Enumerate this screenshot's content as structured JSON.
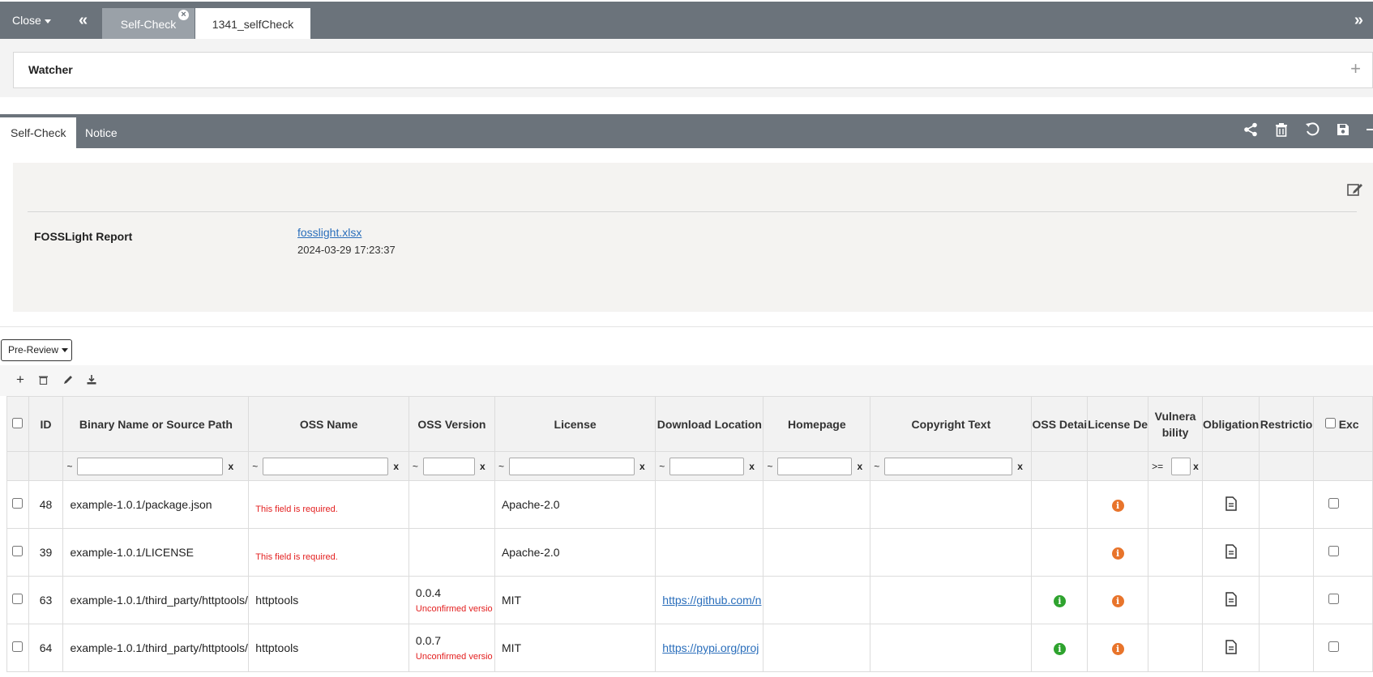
{
  "topbar": {
    "close_label": "Close",
    "tabs": [
      {
        "label": "Self-Check",
        "active": false
      },
      {
        "label": "1341_selfCheck",
        "active": true
      }
    ]
  },
  "watcher": {
    "title": "Watcher"
  },
  "subtabs": [
    {
      "label": "Self-Check",
      "active": true
    },
    {
      "label": "Notice",
      "active": false
    }
  ],
  "toolbar_icons": [
    "share-icon",
    "trash-icon",
    "undo-icon",
    "save-icon"
  ],
  "report": {
    "label": "FOSSLight Report",
    "file": "fosslight.xlsx",
    "date": "2024-03-29 17:23:37"
  },
  "prereview_label": "Pre-Review",
  "grid": {
    "columns": [
      "ID",
      "Binary Name or Source Path",
      "OSS Name",
      "OSS Version",
      "License",
      "Download Location",
      "Homepage",
      "Copyright Text",
      "OSS Detai",
      "License De",
      "Vulnera bility",
      "Obligation",
      "Restrictio",
      "Exc"
    ],
    "filter_prefix": "~",
    "filter_clear": "x",
    "vuln_prefix": ">=",
    "rows": [
      {
        "id": "48",
        "path": "example-1.0.1/package.json",
        "oss_name": "",
        "oss_error": "This field is required.",
        "version": "",
        "version_note": "",
        "license": "Apache-2.0",
        "download": "",
        "oss_detail": false
      },
      {
        "id": "39",
        "path": "example-1.0.1/LICENSE",
        "oss_name": "",
        "oss_error": "This field is required.",
        "version": "",
        "version_note": "",
        "license": "Apache-2.0",
        "download": "",
        "oss_detail": false
      },
      {
        "id": "63",
        "path": "example-1.0.1/third_party/httptools/",
        "oss_name": "httptools",
        "oss_error": "",
        "version": "0.0.4",
        "version_note": "Unconfirmed versio",
        "license": "MIT",
        "download": "https://github.com/n",
        "oss_detail": true
      },
      {
        "id": "64",
        "path": "example-1.0.1/third_party/httptools/",
        "oss_name": "httptools",
        "oss_error": "",
        "version": "0.0.7",
        "version_note": "Unconfirmed versio",
        "license": "MIT",
        "download": "https://pypi.org/proj",
        "oss_detail": true
      }
    ]
  }
}
